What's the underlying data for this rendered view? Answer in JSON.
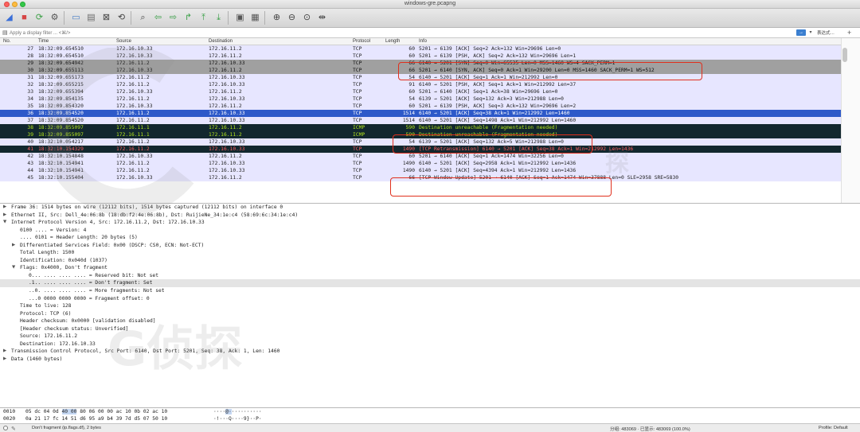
{
  "window": {
    "title": "windows-gre.pcapng"
  },
  "colors": {
    "tcp_row": "#e7e6ff",
    "selected_row": "#2d59c9",
    "gray_row": "#a0a0a0",
    "icmp_row": "#12272e",
    "icmp_text": "#b5e61d",
    "retrans_row": "#12272e",
    "retrans_text": "#ff5f5f",
    "highlight_box": "#e0301e"
  },
  "toolbar": {
    "buttons": [
      {
        "name": "shark-fin-start-icon",
        "glyph": "◢",
        "color": "#3a6fd8"
      },
      {
        "name": "stop-capture-icon",
        "glyph": "■",
        "color": "#d64545"
      },
      {
        "name": "restart-capture-icon",
        "glyph": "⟳",
        "color": "#3da147"
      },
      {
        "name": "capture-options-icon",
        "glyph": "⚙",
        "color": "#555555"
      },
      {
        "name": "open-file-icon",
        "glyph": "▭",
        "color": "#4a7fc8"
      },
      {
        "name": "save-file-icon",
        "glyph": "▤",
        "color": "#6a6a6a"
      },
      {
        "name": "close-file-icon",
        "glyph": "⊠",
        "color": "#444444"
      },
      {
        "name": "reload-file-icon",
        "glyph": "⟲",
        "color": "#444444"
      },
      {
        "name": "find-packet-icon",
        "glyph": "⌕",
        "color": "#444444"
      },
      {
        "name": "go-back-icon",
        "glyph": "⇦",
        "color": "#3ba048"
      },
      {
        "name": "go-forward-icon",
        "glyph": "⇨",
        "color": "#3ba048"
      },
      {
        "name": "go-to-packet-icon",
        "glyph": "↱",
        "color": "#3ba048"
      },
      {
        "name": "go-first-icon",
        "glyph": "⤒",
        "color": "#3ba048"
      },
      {
        "name": "go-last-icon",
        "glyph": "⤓",
        "color": "#3ba048"
      },
      {
        "name": "autoscroll-icon",
        "glyph": "▣",
        "color": "#555555"
      },
      {
        "name": "colorize-icon",
        "glyph": "▦",
        "color": "#555555"
      },
      {
        "name": "zoom-in-icon",
        "glyph": "⊕",
        "color": "#444444"
      },
      {
        "name": "zoom-out-icon",
        "glyph": "⊖",
        "color": "#444444"
      },
      {
        "name": "zoom-normal-icon",
        "glyph": "⊙",
        "color": "#444444"
      },
      {
        "name": "resize-columns-icon",
        "glyph": "⇹",
        "color": "#444444"
      }
    ]
  },
  "filter": {
    "placeholder": "Apply a display filter ... <⌘/>",
    "expression_label": "表达式…",
    "plus_label": "+"
  },
  "columns": {
    "no": "No.",
    "time": "Time",
    "source": "Source",
    "destination": "Destination",
    "protocol": "Protocol",
    "length": "Length",
    "info": "Info"
  },
  "packets": [
    {
      "no": "27",
      "time": "18:32:09.654510",
      "src": "172.16.10.33",
      "dst": "172.16.11.2",
      "proto": "TCP",
      "len": "60",
      "info": "5201 → 6139 [ACK] Seq=2 Ack=132 Win=29696 Len=0",
      "style": "tcp"
    },
    {
      "no": "28",
      "time": "18:32:09.654510",
      "src": "172.16.10.33",
      "dst": "172.16.11.2",
      "proto": "TCP",
      "len": "60",
      "info": "5201 → 6139 [PSH, ACK] Seq=2 Ack=132 Win=29696 Len=1",
      "style": "tcp"
    },
    {
      "no": "29",
      "time": "18:32:09.654942",
      "src": "172.16.11.2",
      "dst": "172.16.10.33",
      "proto": "TCP",
      "len": "66",
      "info": "6140 → 5201 [SYN] Seq=0 Win=65535 Len=0 MSS=1460 WS=4 SACK_PERM=1",
      "style": "gray"
    },
    {
      "no": "30",
      "time": "18:32:09.655113",
      "src": "172.16.10.33",
      "dst": "172.16.11.2",
      "proto": "TCP",
      "len": "66",
      "info": "5201 → 6140 [SYN, ACK] Seq=0 Ack=1 Win=29200 Len=0 MSS=1460 SACK_PERM=1 WS=512",
      "style": "gray"
    },
    {
      "no": "31",
      "time": "18:32:09.655173",
      "src": "172.16.11.2",
      "dst": "172.16.10.33",
      "proto": "TCP",
      "len": "54",
      "info": "6140 → 5201 [ACK] Seq=1 Ack=1 Win=212992 Len=0",
      "style": "tcp"
    },
    {
      "no": "32",
      "time": "18:32:09.655215",
      "src": "172.16.11.2",
      "dst": "172.16.10.33",
      "proto": "TCP",
      "len": "91",
      "info": "6140 → 5201 [PSH, ACK] Seq=1 Ack=1 Win=212992 Len=37",
      "style": "tcp"
    },
    {
      "no": "33",
      "time": "18:32:09.655394",
      "src": "172.16.10.33",
      "dst": "172.16.11.2",
      "proto": "TCP",
      "len": "60",
      "info": "5201 → 6140 [ACK] Seq=1 Ack=38 Win=29696 Len=0",
      "style": "tcp"
    },
    {
      "no": "34",
      "time": "18:32:09.854135",
      "src": "172.16.11.2",
      "dst": "172.16.10.33",
      "proto": "TCP",
      "len": "54",
      "info": "6139 → 5201 [ACK] Seq=132 Ack=3 Win=212988 Len=0",
      "style": "tcp"
    },
    {
      "no": "35",
      "time": "18:32:09.854320",
      "src": "172.16.10.33",
      "dst": "172.16.11.2",
      "proto": "TCP",
      "len": "60",
      "info": "5201 → 6139 [PSH, ACK] Seq=3 Ack=132 Win=29696 Len=2",
      "style": "tcp"
    },
    {
      "no": "36",
      "time": "18:32:09.854520",
      "src": "172.16.11.2",
      "dst": "172.16.10.33",
      "proto": "TCP",
      "len": "1514",
      "info": "6140 → 5201 [ACK] Seq=38 Ack=1 Win=212992 Len=1460",
      "style": "selected"
    },
    {
      "no": "37",
      "time": "18:32:09.854520",
      "src": "172.16.11.2",
      "dst": "172.16.10.33",
      "proto": "TCP",
      "len": "1514",
      "info": "6140 → 5201 [ACK] Seq=1498 Ack=1 Win=212992 Len=1460",
      "style": "tcp"
    },
    {
      "no": "38",
      "time": "18:32:09.855097",
      "src": "172.16.11.1",
      "dst": "172.16.11.2",
      "proto": "ICMP",
      "len": "590",
      "info": "Destination unreachable (Fragmentation needed)",
      "style": "icmp"
    },
    {
      "no": "39",
      "time": "18:32:09.855097",
      "src": "172.16.11.1",
      "dst": "172.16.11.2",
      "proto": "ICMP",
      "len": "590",
      "info": "Destination unreachable (Fragmentation needed)",
      "style": "icmp"
    },
    {
      "no": "40",
      "time": "18:32:10.054217",
      "src": "172.16.11.2",
      "dst": "172.16.10.33",
      "proto": "TCP",
      "len": "54",
      "info": "6139 → 5201 [ACK] Seq=132 Ack=5 Win=212988 Len=0",
      "style": "tcp"
    },
    {
      "no": "41",
      "time": "18:32:10.154329",
      "src": "172.16.11.2",
      "dst": "172.16.10.33",
      "proto": "TCP",
      "len": "1490",
      "info": "[TCP Retransmission] 6140 → 5201 [ACK] Seq=38 Ack=1 Win=212992 Len=1436",
      "style": "retrans"
    },
    {
      "no": "42",
      "time": "18:32:10.154848",
      "src": "172.16.10.33",
      "dst": "172.16.11.2",
      "proto": "TCP",
      "len": "60",
      "info": "5201 → 6140 [ACK] Seq=1 Ack=1474 Win=32256 Len=0",
      "style": "tcp"
    },
    {
      "no": "43",
      "time": "18:32:10.154941",
      "src": "172.16.11.2",
      "dst": "172.16.10.33",
      "proto": "TCP",
      "len": "1490",
      "info": "6140 → 5201 [ACK] Seq=2958 Ack=1 Win=212992 Len=1436",
      "style": "tcp"
    },
    {
      "no": "44",
      "time": "18:32:10.154941",
      "src": "172.16.11.2",
      "dst": "172.16.10.33",
      "proto": "TCP",
      "len": "1490",
      "info": "6140 → 5201 [ACK] Seq=4394 Ack=1 Win=212992 Len=1436",
      "style": "tcp"
    },
    {
      "no": "45",
      "time": "18:32:10.155404",
      "src": "172.16.10.33",
      "dst": "172.16.11.2",
      "proto": "TCP",
      "len": "66",
      "info": "[TCP Window Update] 5201 → 6140 [ACK] Seq=1 Ack=1474 Win=37888 Len=0 SLE=2958 SRE=5830",
      "style": "tcp"
    }
  ],
  "details": [
    {
      "arrow": "▶",
      "indent": 0,
      "text": "Frame 36: 1514 bytes on wire (12112 bits), 1514 bytes captured (12112 bits) on interface 0"
    },
    {
      "arrow": "▶",
      "indent": 0,
      "text": "Ethernet II, Src: Dell_4e:06:8b (18:db:f2:4e:06:8b), Dst: RuijieNe_34:1e:c4 (58:69:6c:34:1e:c4)"
    },
    {
      "arrow": "▼",
      "indent": 0,
      "text": "Internet Protocol Version 4, Src: 172.16.11.2, Dst: 172.16.10.33"
    },
    {
      "arrow": "",
      "indent": 1,
      "text": "0100 .... = Version: 4"
    },
    {
      "arrow": "",
      "indent": 1,
      "text": ".... 0101 = Header Length: 20 bytes (5)"
    },
    {
      "arrow": "▶",
      "indent": 1,
      "text": "Differentiated Services Field: 0x00 (DSCP: CS0, ECN: Not-ECT)"
    },
    {
      "arrow": "",
      "indent": 1,
      "text": "Total Length: 1500"
    },
    {
      "arrow": "",
      "indent": 1,
      "text": "Identification: 0x040d (1037)"
    },
    {
      "arrow": "▼",
      "indent": 1,
      "text": "Flags: 0x4000, Don't fragment"
    },
    {
      "arrow": "",
      "indent": 2,
      "text": "0... .... .... .... = Reserved bit: Not set"
    },
    {
      "arrow": "",
      "indent": 2,
      "text": ".1.. .... .... .... = Don't fragment: Set",
      "selected": true
    },
    {
      "arrow": "",
      "indent": 2,
      "text": "..0. .... .... .... = More fragments: Not set"
    },
    {
      "arrow": "",
      "indent": 2,
      "text": "...0 0000 0000 0000 = Fragment offset: 0"
    },
    {
      "arrow": "",
      "indent": 1,
      "text": "Time to live: 128"
    },
    {
      "arrow": "",
      "indent": 1,
      "text": "Protocol: TCP (6)"
    },
    {
      "arrow": "",
      "indent": 1,
      "text": "Header checksum: 0x0000 [validation disabled]"
    },
    {
      "arrow": "",
      "indent": 1,
      "text": "[Header checksum status: Unverified]"
    },
    {
      "arrow": "",
      "indent": 1,
      "text": "Source: 172.16.11.2"
    },
    {
      "arrow": "",
      "indent": 1,
      "text": "Destination: 172.16.10.33"
    },
    {
      "arrow": "▶",
      "indent": 0,
      "text": "Transmission Control Protocol, Src Port: 6140, Dst Port: 5201, Seq: 38, Ack: 1, Len: 1460"
    },
    {
      "arrow": "▶",
      "indent": 0,
      "text": "Data (1460 bytes)"
    }
  ],
  "bytes": [
    {
      "offset": "0010",
      "hex_pre": "05 dc 04 0d ",
      "hex_hl": "40 00",
      "hex_post": " 80 06  00 00 ac 10 0b 02 ac 10",
      "ascii_pre": "····",
      "ascii_hl": "@·",
      "ascii_post": "··········"
    },
    {
      "offset": "0020",
      "hex_pre": "0a 21 17 fc 14 51 d6 95  a9 b4 39 7d d5 07 50 10",
      "hex_hl": "",
      "hex_post": "",
      "ascii_pre": "·!···Q····9}··P·",
      "ascii_hl": "",
      "ascii_post": ""
    }
  ],
  "status": {
    "field_info": "Don't fragment (ip.flags.df), 2 bytes",
    "packets_info": "分组: 483069 · 已显示: 483069 (100.0%)",
    "profile": "Profile: Default"
  },
  "watermark": {
    "text": "G侦探",
    "text2": "探"
  }
}
